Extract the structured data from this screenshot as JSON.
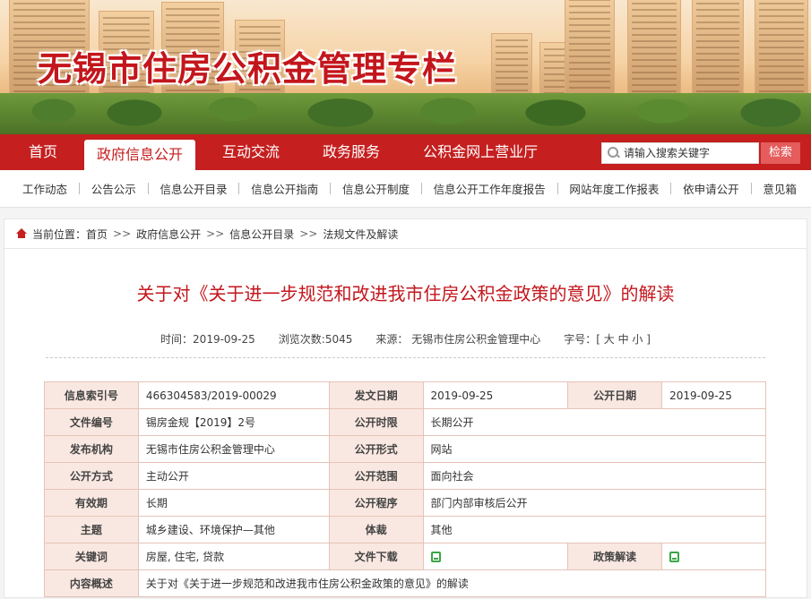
{
  "banner": {
    "title": "无锡市住房公积金管理专栏"
  },
  "main_nav": {
    "items": [
      {
        "label": "首页",
        "active": false
      },
      {
        "label": "政府信息公开",
        "active": true
      },
      {
        "label": "互动交流",
        "active": false
      },
      {
        "label": "政务服务",
        "active": false
      },
      {
        "label": "公积金网上营业厅",
        "active": false
      }
    ],
    "search_placeholder": "请输入搜索关键字",
    "search_button": "检索"
  },
  "sub_nav": {
    "items": [
      "工作动态",
      "公告公示",
      "信息公开目录",
      "信息公开指南",
      "信息公开制度",
      "信息公开工作年度报告",
      "网站年度工作报表",
      "依申请公开",
      "意见箱"
    ]
  },
  "breadcrumb": {
    "label": "当前位置：",
    "items": [
      "首页",
      "政府信息公开",
      "信息公开目录",
      "法规文件及解读"
    ],
    "separator": ">>"
  },
  "article": {
    "title": "关于对《关于进一步规范和改进我市住房公积金政策的意见》的解读",
    "meta": {
      "time": "时间：2019-09-25",
      "views": "浏览次数:5045",
      "source": "来源： 无锡市住房公积金管理中心",
      "font_size_label": "字号：[",
      "size_large": "大",
      "size_medium": "中",
      "size_small": "小",
      "font_size_close": "]"
    }
  },
  "info_table": {
    "index_label": "信息索引号",
    "index_value": "466304583/2019-00029",
    "issue_date_label": "发文日期",
    "issue_date_value": "2019-09-25",
    "open_date_label": "公开日期",
    "open_date_value": "2019-09-25",
    "doc_no_label": "文件编号",
    "doc_no_value": "锡房金规【2019】2号",
    "open_period_label": "公开时限",
    "open_period_value": "长期公开",
    "publisher_label": "发布机构",
    "publisher_value": "无锡市住房公积金管理中心",
    "open_form_label": "公开形式",
    "open_form_value": "网站",
    "open_mode_label": "公开方式",
    "open_mode_value": "主动公开",
    "open_scope_label": "公开范围",
    "open_scope_value": "面向社会",
    "validity_label": "有效期",
    "validity_value": "长期",
    "procedure_label": "公开程序",
    "procedure_value": "部门内部审核后公开",
    "topic_label": "主题",
    "topic_value": "城乡建设、环境保护—其他",
    "genre_label": "体裁",
    "genre_value": "其他",
    "keywords_label": "关键词",
    "keywords_value": "房屋, 住宅, 贷款",
    "download_label": "文件下载",
    "policy_label": "政策解读",
    "summary_label": "内容概述",
    "summary_value": "关于对《关于进一步规范和改进我市住房公积金政策的意见》的解读"
  }
}
